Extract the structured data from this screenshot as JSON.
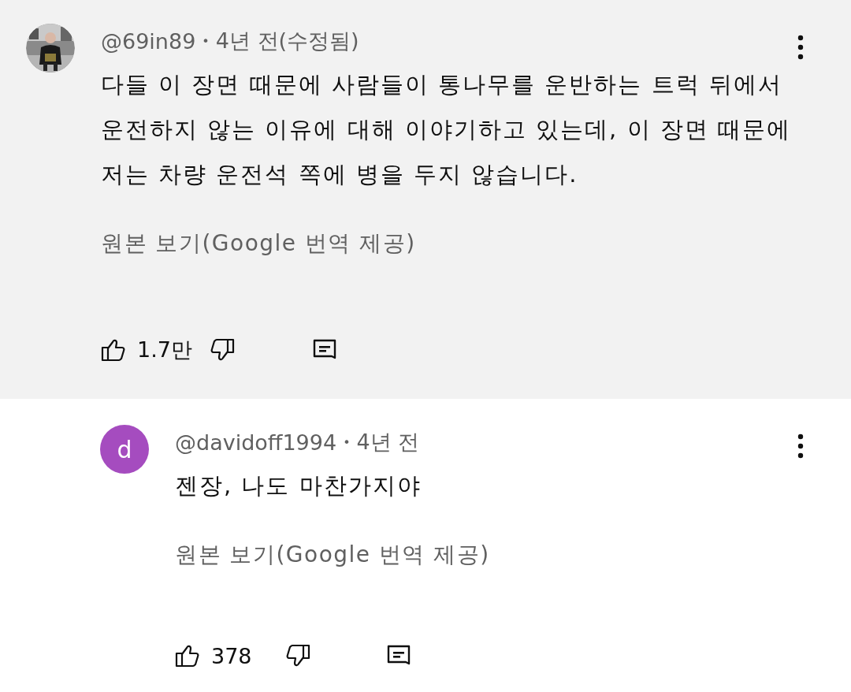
{
  "comments": [
    {
      "kind": "picture",
      "highlighted": true,
      "author": "@69in89",
      "separator": "•",
      "time": "4년 전(수정됨)",
      "text": "다들 이 장면 때문에 사람들이 통나무를 운반하는 트럭 뒤에서 운전하지 않는 이유에 대해 이야기하고 있는데, 이 장면 때문에 저는 차량 운전석 쪽에 병을 두지 않습니다.",
      "translate_link": "원본 보기(Google 번역 제공)",
      "likes": "1.7만"
    },
    {
      "kind": "letter",
      "highlighted": false,
      "avatar_letter": "d",
      "color": "#a54cbf",
      "author": "@davidoff1994",
      "separator": "•",
      "time": "4년 전",
      "text": "젠장, 나도 마찬가지야",
      "translate_link": "원본 보기(Google 번역 제공)",
      "likes": "378"
    }
  ]
}
